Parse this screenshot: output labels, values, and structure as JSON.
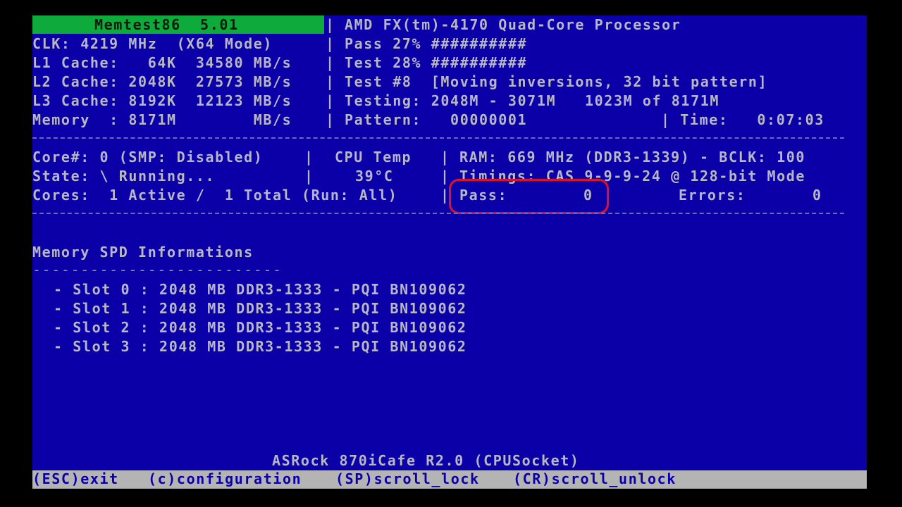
{
  "header": {
    "title": "Memtest86  5.01",
    "processor": "AMD FX(tm)-4170 Quad-Core Processor",
    "clk_label": "CLK: 4219 MHz  (X64 Mode)",
    "l1": "L1 Cache:   64K  34580 MB/s",
    "l2": "L2 Cache: 2048K  27573 MB/s",
    "l3": "L3 Cache: 8192K  12123 MB/s",
    "memory": "Memory  : 8171M        MB/s",
    "pass_progress": "Pass 27% ##########",
    "test_progress": "Test 28% ##########",
    "test_name": "Test #8  [Moving inversions, 32 bit pattern]",
    "testing_range": "Testing: 2048M - 3071M   1023M of 8171M",
    "pattern": "Pattern:   00000001",
    "time": "| Time:   0:07:03",
    "divider": "|"
  },
  "cpu_section": {
    "core": "Core#: 0 (SMP: Disabled)",
    "state": "State: \\ Running...",
    "cores": "Cores:  1 Active /  1 Total (Run: All)",
    "cpu_temp_label": "CPU Temp",
    "cpu_temp_value": "39°C",
    "ram": "RAM: 669 MHz (DDR3-1339) - BCLK: 100",
    "timings": "Timings: CAS 9-9-9-24 @ 128-bit Mode",
    "pass_label": "Pass:",
    "pass_value": "0",
    "errors_label": "Errors:",
    "errors_value": "0",
    "divider": "|"
  },
  "spd": {
    "heading": "Memory SPD Informations",
    "underline": "--------------------------",
    "slots": [
      "- Slot 0 : 2048 MB DDR3-1333 - PQI BN109062",
      "- Slot 1 : 2048 MB DDR3-1333 - PQI BN109062",
      "- Slot 2 : 2048 MB DDR3-1333 - PQI BN109062",
      "- Slot 3 : 2048 MB DDR3-1333 - PQI BN109062"
    ]
  },
  "footer": {
    "board": "ASRock 870iCafe R2.0 (CPUSocket)",
    "esc": "(ESC)exit",
    "config": "(c)configuration",
    "scroll_lock": "(SP)scroll_lock",
    "scroll_unlock": "(CR)scroll_unlock"
  },
  "colors": {
    "background": "#0b00a8",
    "title_bar": "#0eaa3c",
    "text": "#b8b8c4",
    "status_bar": "#b4b4b4",
    "highlight_circle": "#e0102a"
  }
}
